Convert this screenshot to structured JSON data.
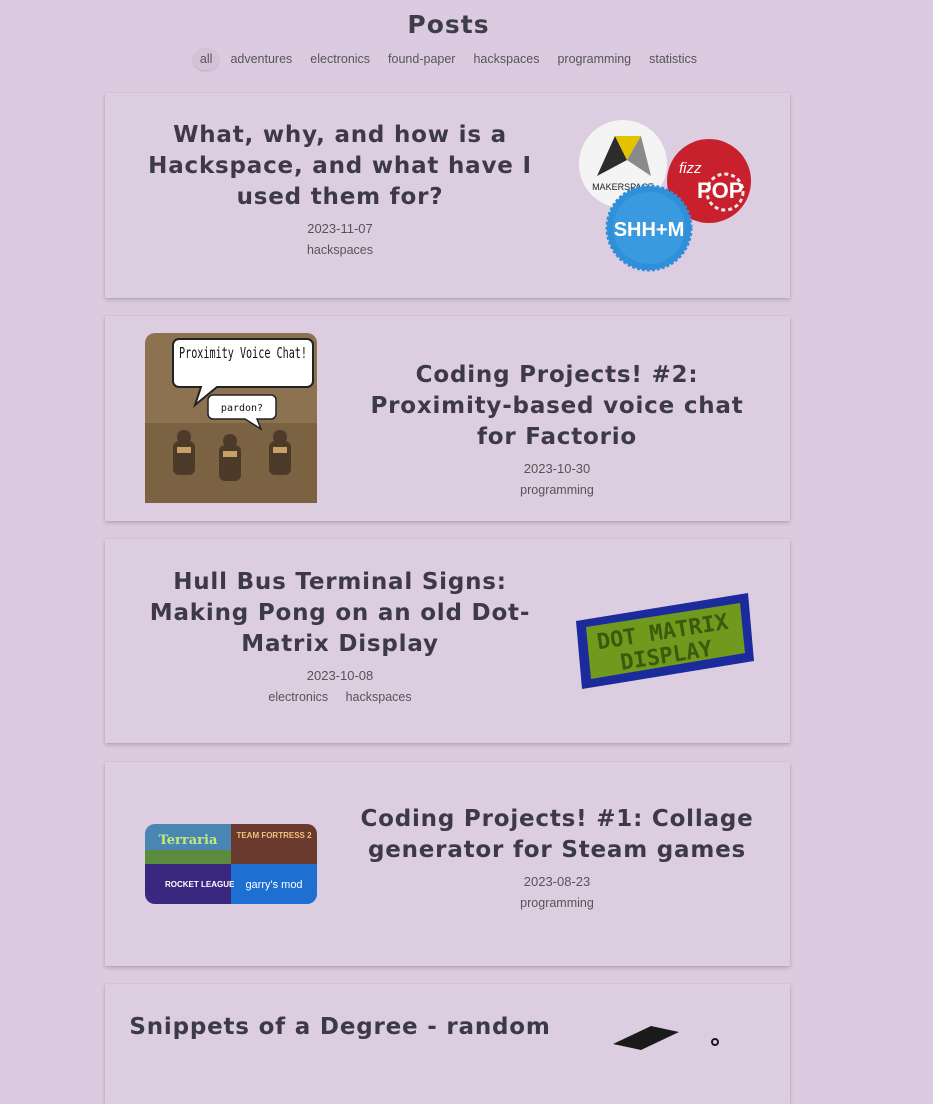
{
  "page": {
    "title": "Posts"
  },
  "filters": [
    "all",
    "adventures",
    "electronics",
    "found-paper",
    "hackspaces",
    "programming",
    "statistics"
  ],
  "active_filter": "all",
  "posts": [
    {
      "title": "What, why, and how is a Hackspace, and what have I used them for?",
      "date": "2023-11-07",
      "tags": [
        "hackspaces"
      ],
      "thumb_text": {
        "makerspace": "MAKERSPACE",
        "fizz": "fizz",
        "pop": "POP",
        "shhm": "SHH+M"
      }
    },
    {
      "title": "Coding Projects! #2: Proximity-based voice chat for Factorio",
      "date": "2023-10-30",
      "tags": [
        "programming"
      ],
      "thumb_text": {
        "bubble1": "Proximity Voice Chat!",
        "bubble2": "pardon?"
      }
    },
    {
      "title": "Hull Bus Terminal Signs: Making Pong on an old Dot-Matrix Display",
      "date": "2023-10-08",
      "tags": [
        "electronics",
        "hackspaces"
      ],
      "thumb_text": {
        "line1": "DOT MATRIX",
        "line2": "DISPLAY"
      }
    },
    {
      "title": "Coding Projects! #1: Collage generator for Steam games",
      "date": "2023-08-23",
      "tags": [
        "programming"
      ],
      "thumb_text": {
        "g1": "Terraria",
        "g2": "TEAM FORTRESS 2",
        "g3": "ROCKET LEAGUE",
        "g4": "garry's mod"
      }
    },
    {
      "title": "Snippets of a Degree - random",
      "date": "",
      "tags": []
    }
  ],
  "colors": {
    "background": "#dccbe0",
    "card": "#ddcde1",
    "title": "#3d3a48",
    "pop_red": "#c8202c",
    "shhm_blue": "#2f8fd8",
    "lcd_green": "#6f9a1e",
    "lcd_frame": "#1b2a9c"
  }
}
